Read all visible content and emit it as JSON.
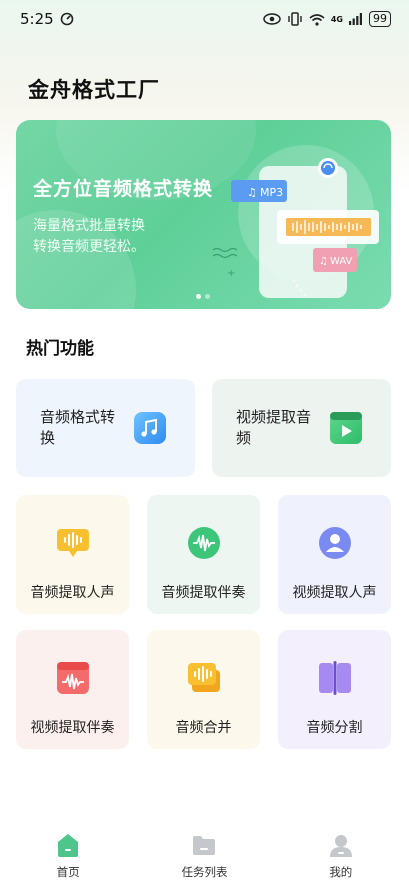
{
  "status_bar": {
    "time": "5:25",
    "signal": "4G",
    "battery": "99"
  },
  "app_title": "金舟格式工厂",
  "banner": {
    "title": "全方位音频格式转换",
    "subtitle_line1": "海量格式批量转换",
    "subtitle_line2": "转换音频更轻松。",
    "tag_mp3": "MP3",
    "tag_wav": "WAV"
  },
  "section_title": "热门功能",
  "big_features": [
    {
      "label": "音频格式转换",
      "icon": "music-note-icon"
    },
    {
      "label": "视频提取音频",
      "icon": "video-play-icon"
    }
  ],
  "small_features": [
    {
      "label": "音频提取人声",
      "icon": "voice-wave-icon"
    },
    {
      "label": "音频提取伴奏",
      "icon": "accompaniment-wave-icon"
    },
    {
      "label": "视频提取人声",
      "icon": "person-icon"
    },
    {
      "label": "视频提取伴奏",
      "icon": "video-wave-icon"
    },
    {
      "label": "音频合并",
      "icon": "merge-icon"
    },
    {
      "label": "音频分割",
      "icon": "split-icon"
    }
  ],
  "colors": {
    "accent": "#5fcf98",
    "nav_active": "#4fc58b"
  },
  "bottom_nav": [
    {
      "label": "首页",
      "icon": "home-icon",
      "active": true
    },
    {
      "label": "任务列表",
      "icon": "folder-icon",
      "active": false
    },
    {
      "label": "我的",
      "icon": "profile-icon",
      "active": false
    }
  ]
}
